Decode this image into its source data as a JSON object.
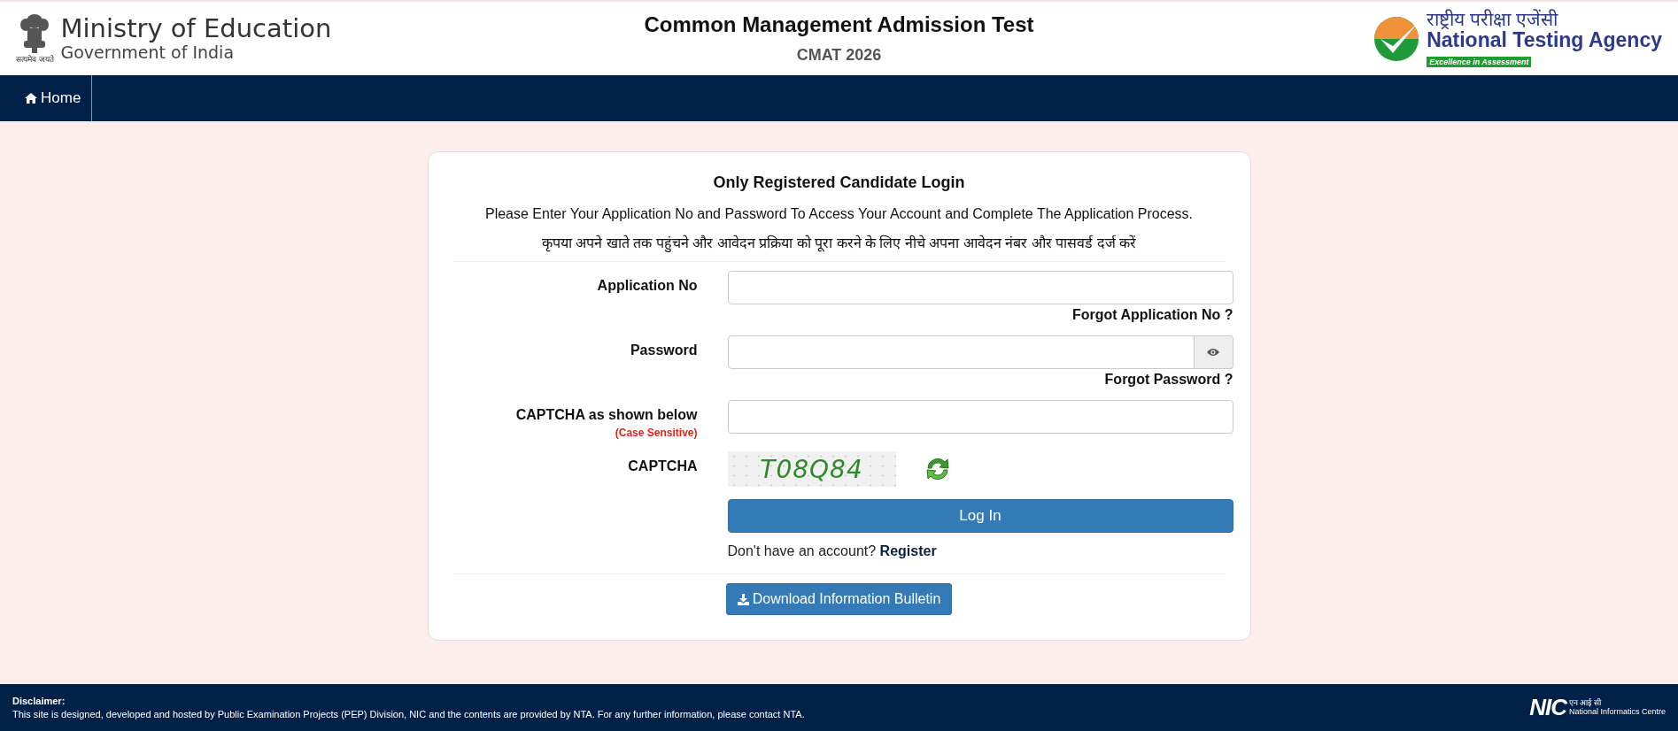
{
  "header": {
    "ministry": {
      "title": "Ministry of Education",
      "subtitle": "Government of India",
      "motto": "सत्यमेव जयते"
    },
    "title": "Common Management Admission Test",
    "subtitle": "CMAT 2026",
    "agency": {
      "hindi": "राष्ट्रीय  परीक्षा  एजेंसी",
      "name": "National Testing Agency",
      "tagline": "Excellence in Assessment"
    }
  },
  "nav": [
    {
      "label": "Home",
      "selected": true
    }
  ],
  "login": {
    "title": "Only Registered Candidate Login",
    "instruction": "Please Enter Your Application No and Password To Access Your Account and Complete The Application Process.",
    "instruction_hindi": "कृपया अपने खाते तक पहुंचने और आवेदन प्रक्रिया को पूरा करने के लिए नीचे अपना आवेदन नंबर और पासवर्ड दर्ज करें",
    "fields": [
      {
        "kind": "text",
        "label": "Application No",
        "link": "Forgot Application No ?"
      },
      {
        "kind": "password",
        "label": "Password",
        "link": "Forgot Password ?"
      },
      {
        "kind": "text",
        "label": "CAPTCHA as shown below",
        "note": "(Case Sensitive)"
      },
      {
        "kind": "captcha",
        "label": "CAPTCHA",
        "captcha": "T08Q84"
      }
    ],
    "button": "Log In",
    "register_prompt": "Don't have an account?",
    "register_link": "Register",
    "download": "Download Information Bulletin"
  },
  "footer": {
    "heading": "Disclaimer:",
    "text": "This site is designed, developed and hosted by Public Examination Projects (PEP) Division, NIC and the contents are provided by NTA. For any further information, please contact NTA.",
    "logo": {
      "mark": "NIC",
      "hindi": "एन आई सी",
      "name": "National Informatics Centre"
    }
  }
}
